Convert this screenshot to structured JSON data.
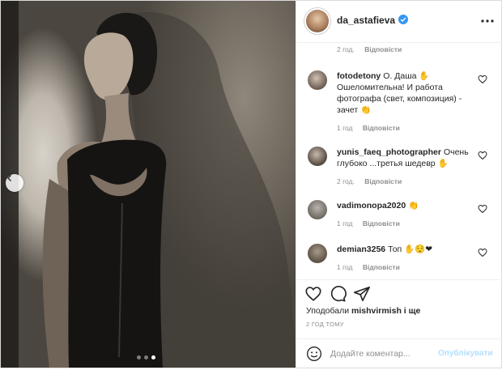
{
  "post": {
    "username": "da_astafieva",
    "verified": true,
    "header_time": "2 год.",
    "reply_label": "Відповісти",
    "carousel": {
      "count": 3,
      "active": 2
    }
  },
  "comments": [
    {
      "user": "fotodetony",
      "text": "О. Даша ✋ Ошеломительна! И работа фотографа (свет, композиция) - зачет 👏",
      "time": "1 год",
      "reply": "Відповісти"
    },
    {
      "user": "yunis_faeq_photographer",
      "text": "Очень глубоко ...третья шедевр ✋",
      "time": "2 год.",
      "reply": "Відповісти"
    },
    {
      "user": "vadimonopa2020",
      "text": "👏",
      "time": "1 год",
      "reply": "Відповісти"
    },
    {
      "user": "demian3256",
      "text": "Топ ✋😌❤",
      "time": "1 год",
      "reply": "Відповісти"
    }
  ],
  "likes": {
    "prefix": "Уподобали",
    "user": "mishvirmish",
    "suffix": "і ще"
  },
  "time_ago": "2 ГОД ТОМУ",
  "add_comment": {
    "placeholder": "Додайте коментар...",
    "publish": "Опублікувати"
  },
  "colors": {
    "accent": "#0095f6",
    "publish_disabled": "#b2dffc",
    "verified": "#3897f0"
  }
}
